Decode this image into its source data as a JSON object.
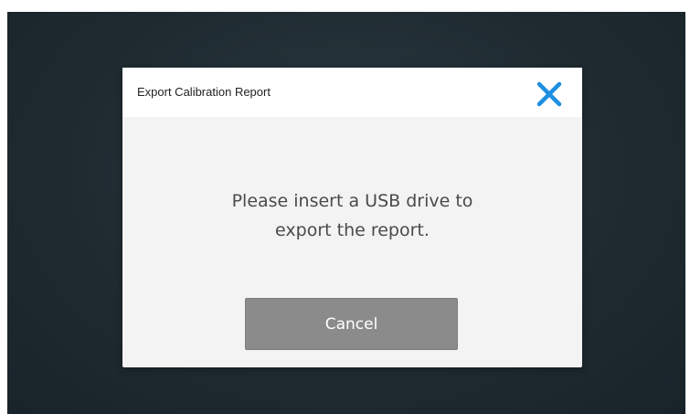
{
  "dialog": {
    "title": "Export Calibration Report",
    "message_line1": "Please insert a USB drive to",
    "message_line2": "export the report.",
    "cancel_label": "Cancel",
    "close_icon": "close-icon"
  },
  "colors": {
    "backdrop": "#1f2b31",
    "dialog_background": "#f3f3f3",
    "header_background": "#ffffff",
    "close_icon": "#1e8fe1",
    "cancel_button": "#8b8b8b",
    "message_text": "#4a4a4a"
  }
}
